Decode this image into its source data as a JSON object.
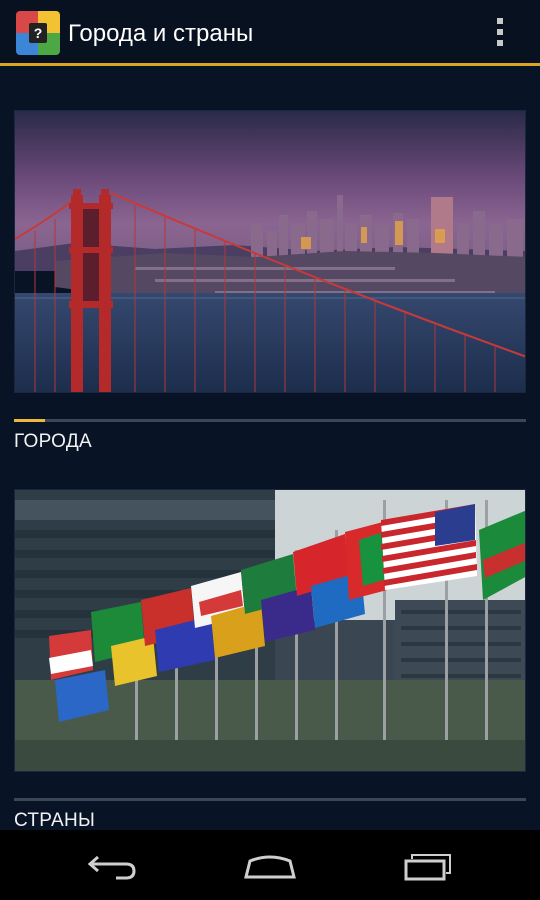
{
  "app": {
    "title": "Города и страны",
    "icon": "quiz-app-icon",
    "icon_glyph": "?",
    "accent_color": "#d9a623"
  },
  "categories": [
    {
      "label": "ГОРОДА",
      "image": "golden-gate-bridge-city-skyline",
      "progress": 0.06
    },
    {
      "label": "СТРАНЫ",
      "image": "row-of-national-flags",
      "progress": 0
    }
  ],
  "navbar": {
    "back": "back-icon",
    "home": "home-icon",
    "recents": "recents-icon"
  }
}
